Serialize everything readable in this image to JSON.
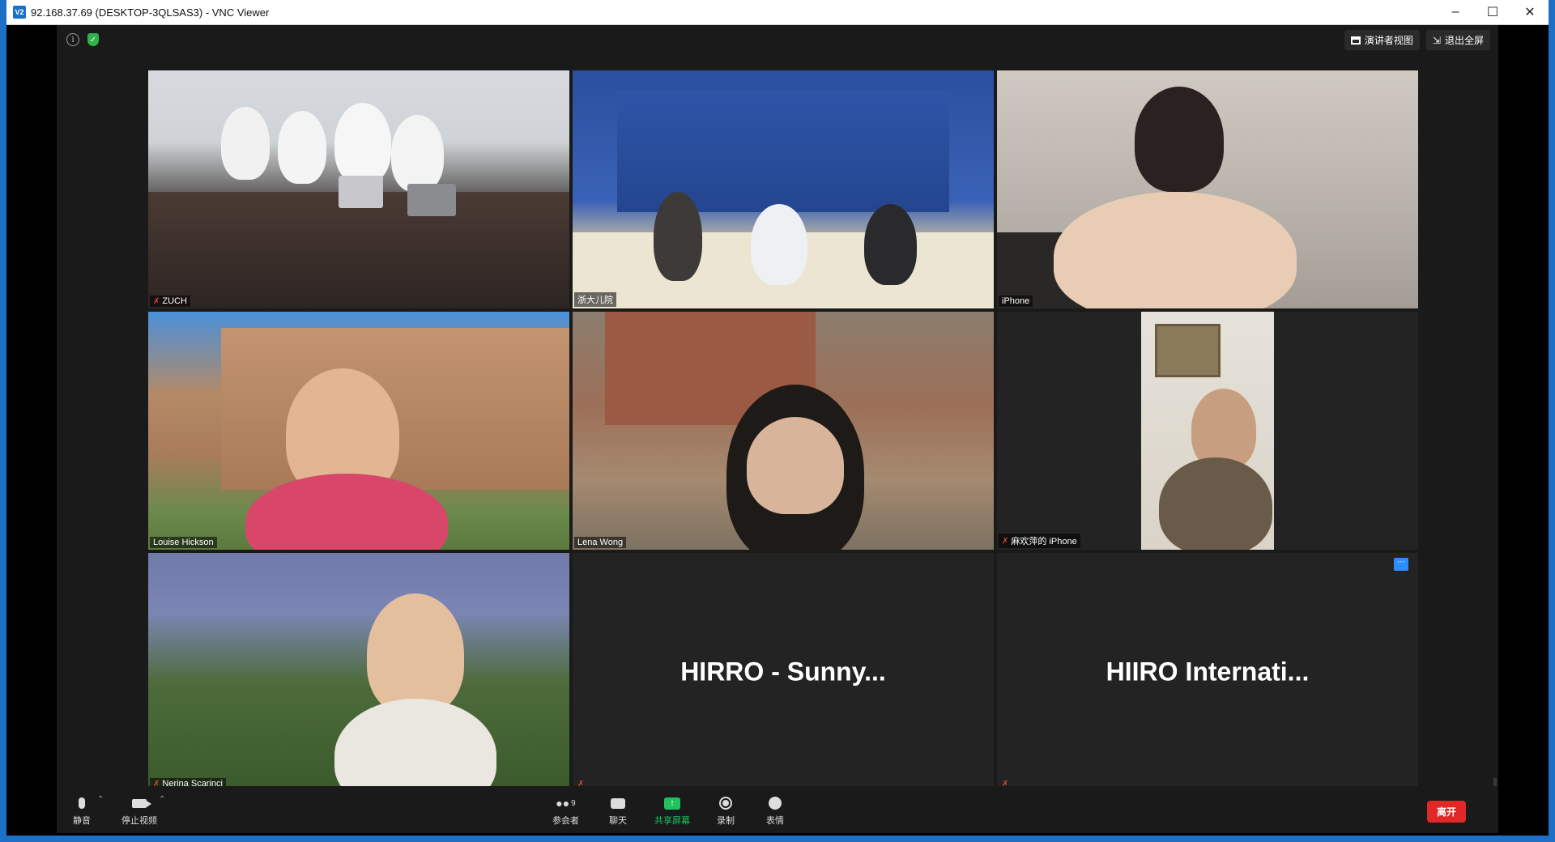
{
  "window": {
    "title": "92.168.37.69 (DESKTOP-3QLSAS3) - VNC Viewer",
    "app_icon_text": "V2"
  },
  "meeting": {
    "speaker_view_label": "演讲者视图",
    "exit_fullscreen_label": "退出全屏",
    "tiles": [
      {
        "label": "ZUCH",
        "muted": true,
        "kind": "video"
      },
      {
        "label": "浙大儿院",
        "muted": false,
        "kind": "video"
      },
      {
        "label": "iPhone",
        "muted": false,
        "kind": "video"
      },
      {
        "label": "Louise Hickson",
        "muted": false,
        "kind": "video",
        "active": true
      },
      {
        "label": "Lena Wong",
        "muted": false,
        "kind": "video"
      },
      {
        "label": "麻欢萍的 iPhone",
        "muted": true,
        "kind": "video"
      },
      {
        "label": "Nerina Scarinci",
        "muted": true,
        "kind": "video"
      },
      {
        "label": "",
        "name_display": "HIRRO  -  Sunny...",
        "muted": true,
        "kind": "placeholder"
      },
      {
        "label": "",
        "name_display": "HIIRO  Internati...",
        "muted": true,
        "kind": "placeholder",
        "more_button": true
      }
    ],
    "toolbar": {
      "mute_label": "静音",
      "stop_video_label": "停止视频",
      "participants_label": "参会者",
      "participants_count": "9",
      "chat_label": "聊天",
      "share_screen_label": "共享屏幕",
      "record_label": "录制",
      "reactions_label": "表情",
      "leave_label": "离开"
    }
  },
  "colors": {
    "active_speaker_border": "#d6e14a",
    "share_green": "#21c25e",
    "leave_red": "#e02828",
    "mute_red": "#e8463d"
  }
}
